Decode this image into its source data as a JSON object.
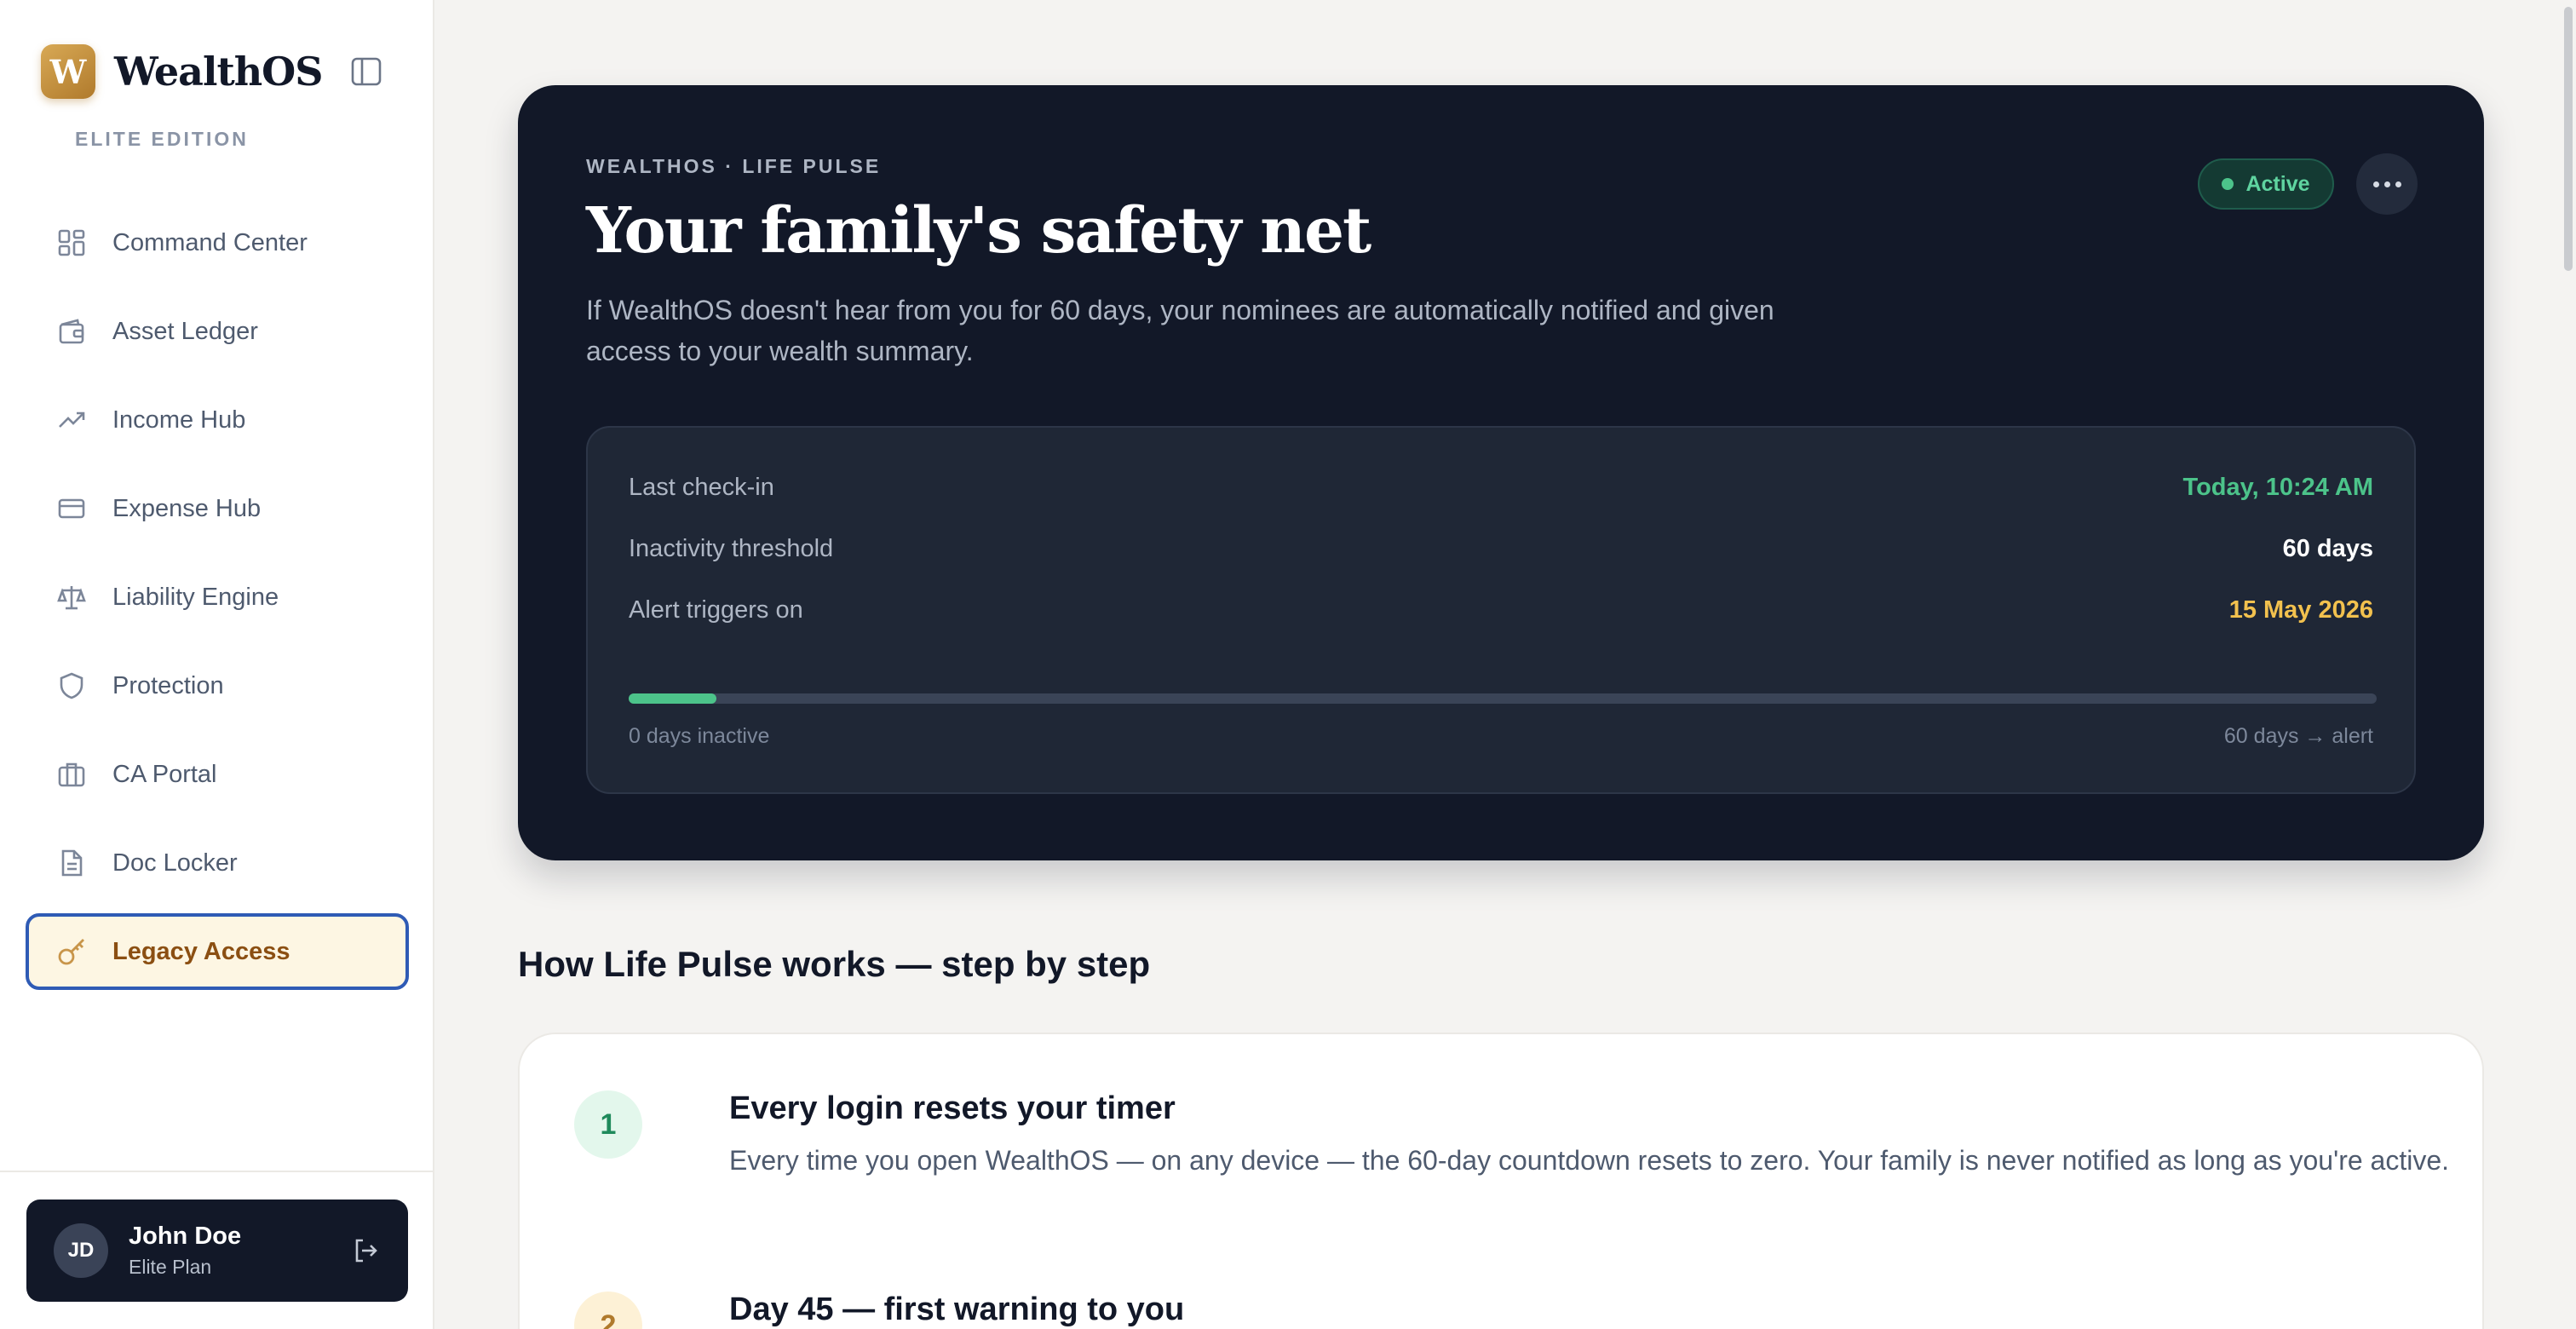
{
  "app": {
    "logo_letter": "W",
    "name": "WealthOS",
    "edition": "ELITE EDITION"
  },
  "nav": [
    {
      "label": "Command Center",
      "icon": "grid-icon"
    },
    {
      "label": "Asset Ledger",
      "icon": "wallet-icon"
    },
    {
      "label": "Income Hub",
      "icon": "trending-up-icon"
    },
    {
      "label": "Expense Hub",
      "icon": "credit-card-icon"
    },
    {
      "label": "Liability Engine",
      "icon": "scale-icon"
    },
    {
      "label": "Protection",
      "icon": "shield-icon"
    },
    {
      "label": "CA Portal",
      "icon": "briefcase-icon"
    },
    {
      "label": "Doc Locker",
      "icon": "document-icon"
    },
    {
      "label": "Legacy Access",
      "icon": "key-icon",
      "active": true
    }
  ],
  "user": {
    "initials": "JD",
    "name": "John Doe",
    "plan": "Elite Plan"
  },
  "hero": {
    "eyebrow": "WEALTHOS · LIFE PULSE",
    "title": "Your family's safety net",
    "subtitle": "If WealthOS doesn't hear from you for 60 days, your nominees are automatically notified and given access to your wealth summary.",
    "status": "Active",
    "stats": [
      {
        "label": "Last check-in",
        "value": "Today, 10:24 AM",
        "color": "#4cc38a"
      },
      {
        "label": "Inactivity threshold",
        "value": "60 days",
        "color": "#ffffff"
      },
      {
        "label": "Alert triggers on",
        "value": "15 May 2026",
        "color": "#f2c14e"
      }
    ],
    "progress": {
      "fraction": 0.05,
      "start_label": "0 days inactive",
      "end_label": "60 days → alert"
    }
  },
  "steps_section": {
    "title": "How Life Pulse works — step by step",
    "steps": [
      {
        "num": "1",
        "title": "Every login resets your timer",
        "desc": "Every time you open WealthOS — on any device — the 60-day countdown resets to zero. Your family is never notified as long as you're active.",
        "color": "#1f8a5b",
        "bg": "#e3f7ec"
      },
      {
        "num": "2",
        "title": "Day 45 — first warning to you",
        "desc": "",
        "color": "#b07a2c",
        "bg": "#fdf1d6"
      }
    ]
  },
  "colors": {
    "accent_gold": "#c8954a",
    "navy": "#121828",
    "active_border": "#2f5bb5"
  }
}
